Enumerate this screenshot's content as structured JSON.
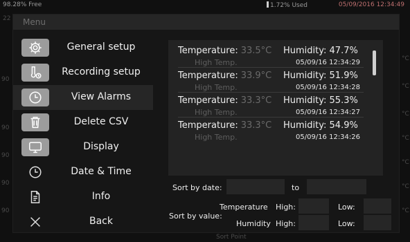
{
  "status_bar": {
    "free": "98.28% Free",
    "used": "1.72% Used",
    "datetime": "05/09/2016 12:34:49"
  },
  "background_marks": [
    "22",
    "°C",
    "°C",
    "°C",
    "°C",
    "°C",
    "°C",
    "°C",
    "90",
    "90",
    "90",
    "90",
    "90",
    "Sort Point"
  ],
  "dialog": {
    "title": "Menu"
  },
  "menu": [
    {
      "icon": "gear-icon",
      "label": "General setup"
    },
    {
      "icon": "recording-probe-icon",
      "label": "Recording setup"
    },
    {
      "icon": "clock-icon",
      "label": "View Alarms"
    },
    {
      "icon": "trash-icon",
      "label": "Delete CSV"
    },
    {
      "icon": "monitor-icon",
      "label": "Display"
    },
    {
      "icon": "clock-icon",
      "label": "Date & Time"
    },
    {
      "icon": "document-icon",
      "label": "Info"
    },
    {
      "icon": "close-icon",
      "label": "Back"
    }
  ],
  "alarms": [
    {
      "temp_label": "Temperature:",
      "temp_value": "33.5°C",
      "hum_label": "Humidity:",
      "hum_value": "47.7%",
      "alarm": "High Temp.",
      "timestamp": "05/09/16 12:34:29"
    },
    {
      "temp_label": "Temperature:",
      "temp_value": "33.9°C",
      "hum_label": "Humidity:",
      "hum_value": "51.9%",
      "alarm": "High Temp.",
      "timestamp": "05/09/16 12:34:28"
    },
    {
      "temp_label": "Temperature:",
      "temp_value": "33.3°C",
      "hum_label": "Humidity:",
      "hum_value": "55.3%",
      "alarm": "High Temp.",
      "timestamp": "05/09/16 12:34:27"
    },
    {
      "temp_label": "Temperature:",
      "temp_value": "33.3°C",
      "hum_label": "Humidity:",
      "hum_value": "54.9%",
      "alarm": "High Temp.",
      "timestamp": "05/09/16 12:34:26"
    }
  ],
  "sort": {
    "by_date_label": "Sort by date:",
    "to_label": "to",
    "by_value_label": "Sort by value:",
    "temperature_label": "Temperature",
    "humidity_label": "Humidity",
    "high_label": "High:",
    "low_label": "Low:",
    "date_from": "",
    "date_to": "",
    "temp_high": "",
    "temp_low": "",
    "hum_high": "",
    "hum_low": ""
  }
}
